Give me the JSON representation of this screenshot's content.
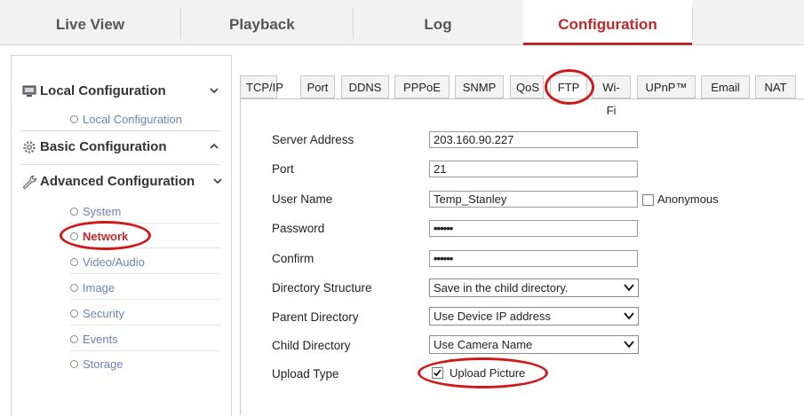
{
  "topnav": {
    "items": [
      {
        "label": "Live View"
      },
      {
        "label": "Playback"
      },
      {
        "label": "Log"
      },
      {
        "label": "Configuration"
      }
    ]
  },
  "sidebar": {
    "local": {
      "label": "Local Configuration",
      "items": [
        "Local Configuration"
      ]
    },
    "basic": {
      "label": "Basic Configuration"
    },
    "advanced": {
      "label": "Advanced Configuration",
      "items": [
        "System",
        "Network",
        "Video/Audio",
        "Image",
        "Security",
        "Events",
        "Storage"
      ]
    },
    "active_item": "Network"
  },
  "tabs": [
    "TCP/IP",
    "Port",
    "DDNS",
    "PPPoE",
    "SNMP",
    "QoS",
    "FTP",
    "Wi-Fi",
    "UPnP™",
    "Email",
    "NAT"
  ],
  "active_tab": "FTP",
  "form": {
    "server_address": {
      "label": "Server Address",
      "value": "203.160.90.227"
    },
    "port": {
      "label": "Port",
      "value": "21"
    },
    "user_name": {
      "label": "User Name",
      "value": "Temp_Stanley"
    },
    "anonymous": {
      "label": "Anonymous",
      "checked": false
    },
    "password": {
      "label": "Password",
      "value": "••••••"
    },
    "confirm": {
      "label": "Confirm",
      "value": "••••••"
    },
    "directory_structure": {
      "label": "Directory Structure",
      "value": "Save in the child directory."
    },
    "parent_directory": {
      "label": "Parent Directory",
      "value": "Use Device IP address"
    },
    "child_directory": {
      "label": "Child Directory",
      "value": "Use Camera Name"
    },
    "upload_type": {
      "label": "Upload Type"
    },
    "upload_picture": {
      "label": "Upload Picture",
      "checked": true
    }
  },
  "colors": {
    "accent": "#c0272d",
    "link": "#6b84b5",
    "annotation": "#d01a1a"
  }
}
